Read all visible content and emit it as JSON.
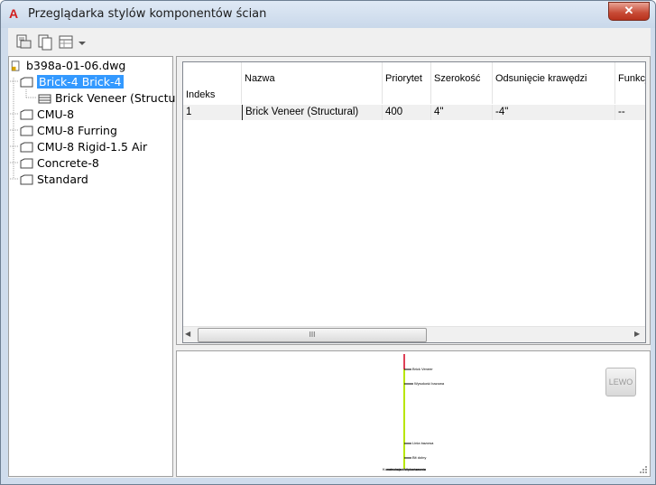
{
  "window": {
    "title": "Przeglądarka stylów komponentów ścian",
    "close_label": "✕"
  },
  "toolbar": {
    "icons": [
      "copy-style-icon",
      "paste-style-icon",
      "table-view-icon"
    ]
  },
  "tree": {
    "root": "b398a-01-06.dwg",
    "styles": [
      {
        "label": "Brick-4 Brick-4",
        "selected": true,
        "children": [
          "Brick Veneer (Structural)"
        ]
      },
      {
        "label": "CMU-8"
      },
      {
        "label": "CMU-8 Furring"
      },
      {
        "label": "CMU-8 Rigid-1.5 Air"
      },
      {
        "label": "Concrete-8"
      },
      {
        "label": "Standard"
      }
    ]
  },
  "grid": {
    "columns": [
      "Indeks",
      "Nazwa",
      "Priorytet",
      "Szerokość",
      "Odsunięcie krawędzi",
      "Funkcja"
    ],
    "rows": [
      [
        "1",
        "Brick Veneer (Structural)",
        "400",
        "4\"",
        "-4\"",
        "--"
      ]
    ],
    "scroll_grip": "III"
  },
  "preview": {
    "button_label": "LEWO",
    "labels": [
      "Brick Veneer",
      "Wysokość bazowa",
      "Linia bazowa",
      "Bit dolny",
      "Konstrukcja / Wykończenie"
    ]
  }
}
